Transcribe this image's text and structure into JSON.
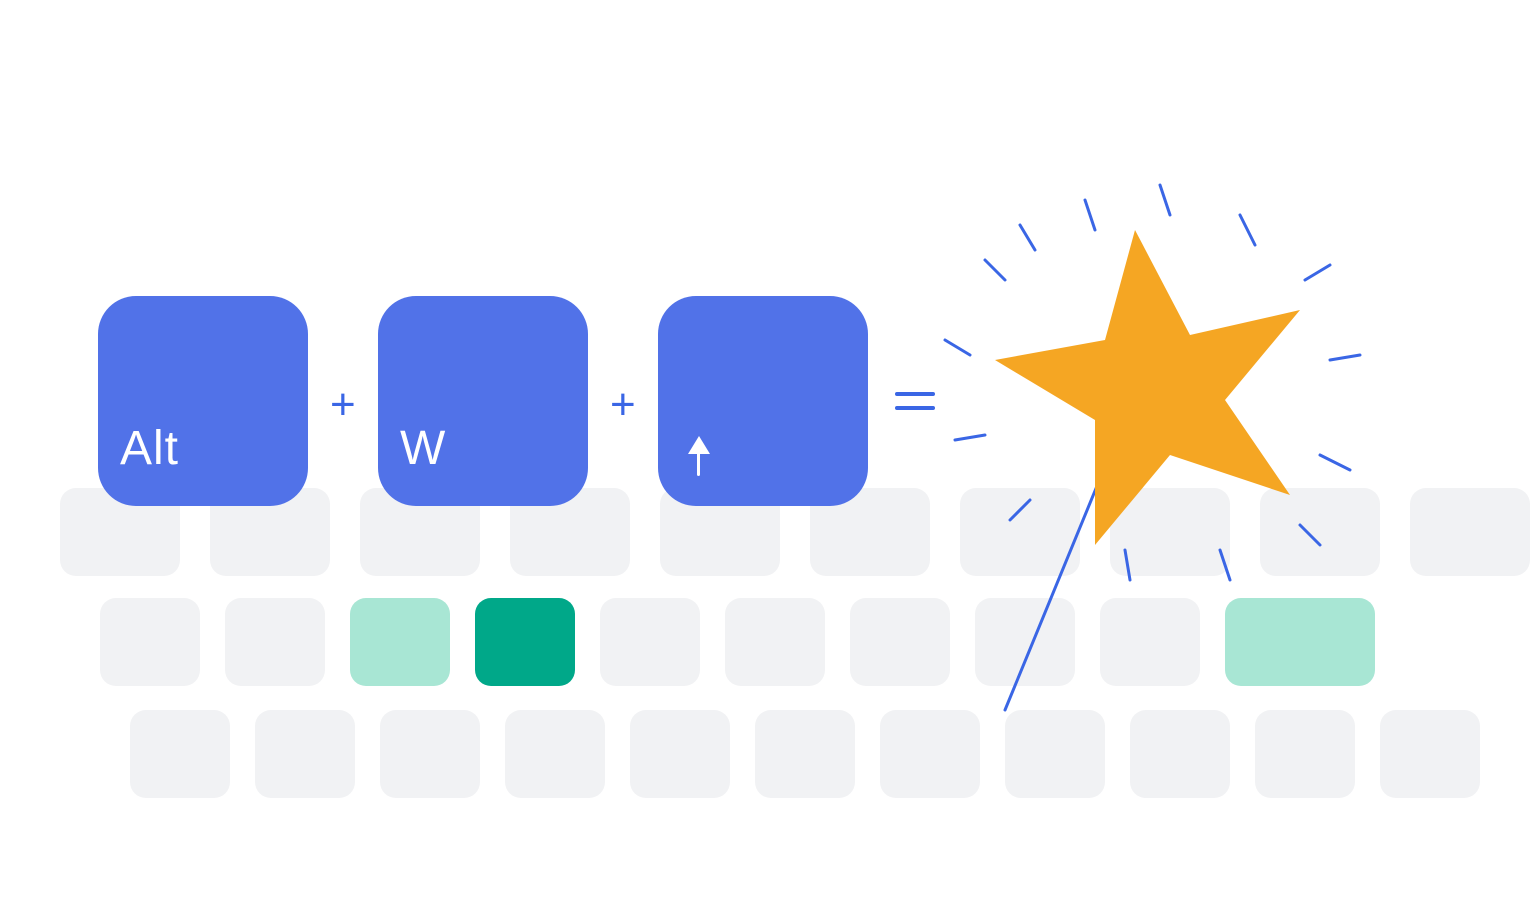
{
  "shortcut": {
    "keys": [
      {
        "label": "Alt",
        "type": "text"
      },
      {
        "label": "W",
        "type": "text"
      },
      {
        "label": "↑",
        "type": "arrow-up"
      }
    ],
    "separator": "+",
    "equals": "="
  },
  "colors": {
    "key_blue": "#5172E8",
    "operator_blue": "#3A66E5",
    "star_orange": "#F5A623",
    "kb_grey": "#F1F2F4",
    "accent_teal_light": "#A8E6D4",
    "accent_teal_dark": "#00A889"
  },
  "background_keyboard": {
    "row1_cols": 10,
    "row2_cols": 10,
    "row3_cols": 11,
    "row2_highlight_light_index": 2,
    "row2_highlight_dark_index": 3,
    "row2_highlight_right_index": 9
  },
  "result": {
    "icon": "magic-wand-star"
  }
}
